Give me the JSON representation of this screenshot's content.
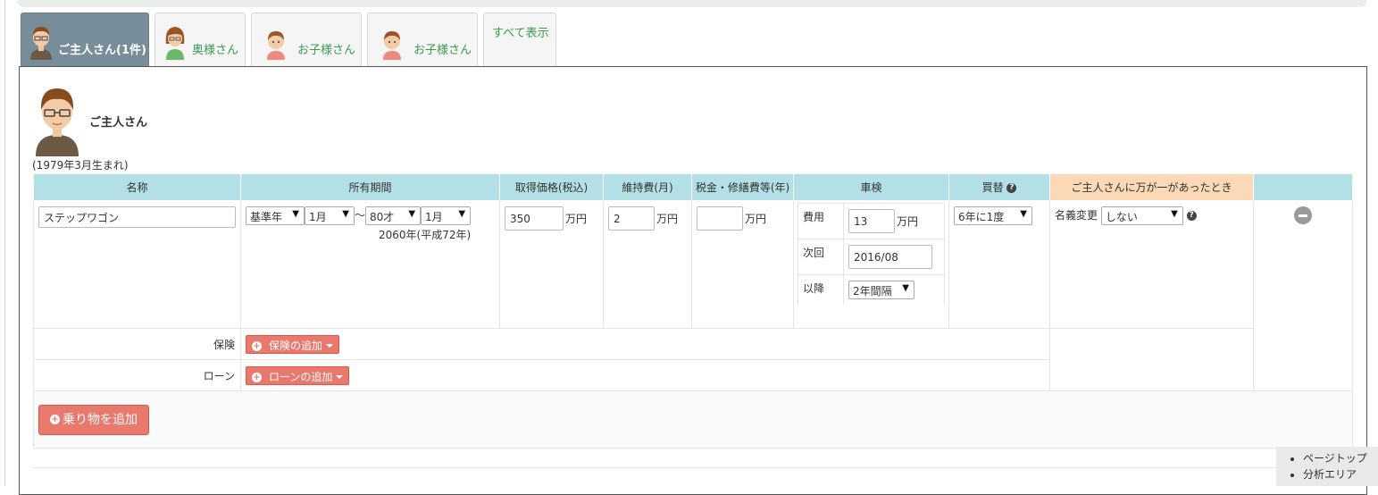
{
  "tabs": [
    {
      "label": "ご主人さん(1件)",
      "avatar": "husband-avatar-icon"
    },
    {
      "label": "奥様さん",
      "avatar": "wife-avatar-icon"
    },
    {
      "label": "お子様さん",
      "avatar": "child-avatar-icon"
    },
    {
      "label": "お子様さん",
      "avatar": "child-avatar-icon"
    },
    {
      "label": "すべて表示"
    }
  ],
  "person": {
    "name": "ご主人さん",
    "birth": "(1979年3月生まれ)"
  },
  "headers": {
    "name": "名称",
    "period": "所有期間",
    "price": "取得価格(税込)",
    "maintenance": "維持費(月)",
    "tax": "税金・修繕費等(年)",
    "inspection": "車検",
    "replace": "買替",
    "death": "ご主人さんに万が一があったとき"
  },
  "vehicle": {
    "name": "ステップワゴン",
    "period": {
      "start": "基準年",
      "start_month": "1月",
      "tilde": "〜",
      "end": "80才",
      "end_month": "1月",
      "end_year": "2060年(平成72年)"
    },
    "price": {
      "value": "350",
      "unit": "万円"
    },
    "maintenance": {
      "value": "2",
      "unit": "万円"
    },
    "tax": {
      "value": "",
      "unit": "万円"
    },
    "inspection": {
      "cost_label": "費用",
      "cost_value": "13",
      "cost_unit": "万円",
      "next_label": "次回",
      "next_value": "2016/08",
      "after_label": "以降",
      "after_value": "2年間隔"
    },
    "replace": "6年に1度",
    "death": {
      "label": "名義変更",
      "value": "しない"
    }
  },
  "insurance": {
    "label": "保険",
    "button": "保険の追加"
  },
  "loan": {
    "label": "ローン",
    "button": "ローンの追加"
  },
  "add_vehicle": "乗り物を追加",
  "float_nav": [
    "ページトップ",
    "分析エリア"
  ],
  "colors": {
    "accent": "#e9786d",
    "header": "#b3e0e6",
    "death_header": "#fbd8b6",
    "tab_active": "#778d9a",
    "tab_text": "#3c9b53"
  }
}
